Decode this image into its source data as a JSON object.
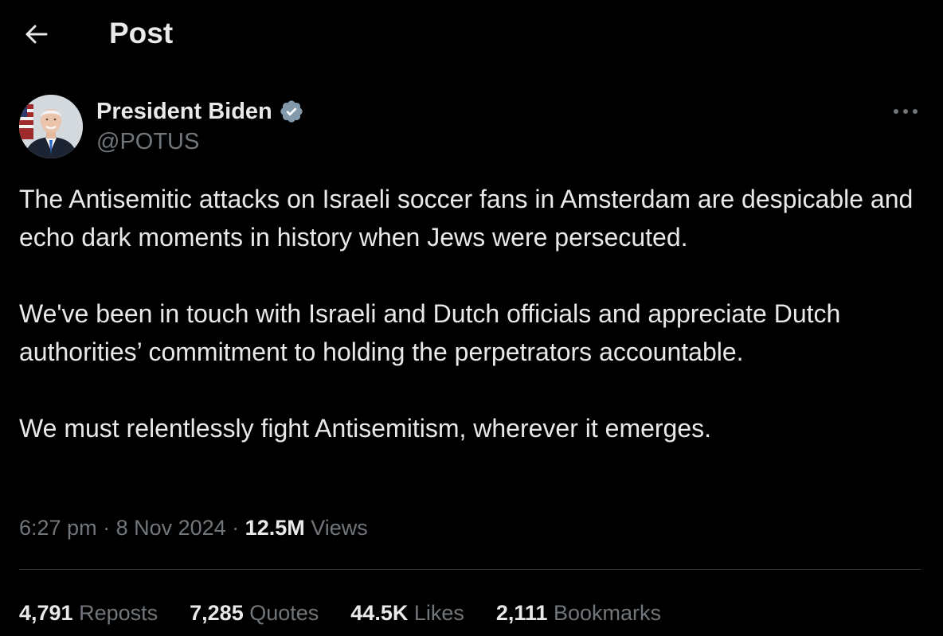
{
  "header": {
    "title": "Post",
    "back_icon": "arrow-left-icon"
  },
  "author": {
    "name": "President Biden",
    "handle": "@POTUS",
    "verified_icon": "verified-badge-icon",
    "verified_color": "#1d9bf0"
  },
  "more_icon": "more-horizontal-icon",
  "tweet": {
    "paragraphs": [
      "The Antisemitic attacks on Israeli soccer fans in Amsterdam are despicable and echo dark moments in history when Jews were persecuted.",
      "We've been in touch with Israeli and Dutch officials and appreciate Dutch authorities’ commitment to holding the perpetrators accountable.",
      "We must relentlessly fight Antisemitism, wherever it emerges."
    ]
  },
  "meta": {
    "time": "6:27 pm",
    "sep1": " · ",
    "date": "8 Nov 2024",
    "sep2": " · ",
    "views_count": "12.5M",
    "views_label": " Views"
  },
  "stats": {
    "reposts": {
      "count": "4,791",
      "label": " Reposts"
    },
    "quotes": {
      "count": "7,285",
      "label": " Quotes"
    },
    "likes": {
      "count": "44.5K",
      "label": " Likes"
    },
    "bookmarks": {
      "count": "2,111",
      "label": " Bookmarks"
    }
  },
  "colors": {
    "background": "#000000",
    "text_primary": "#e7e9ea",
    "text_secondary": "#71767b",
    "divider": "#2f3336"
  }
}
